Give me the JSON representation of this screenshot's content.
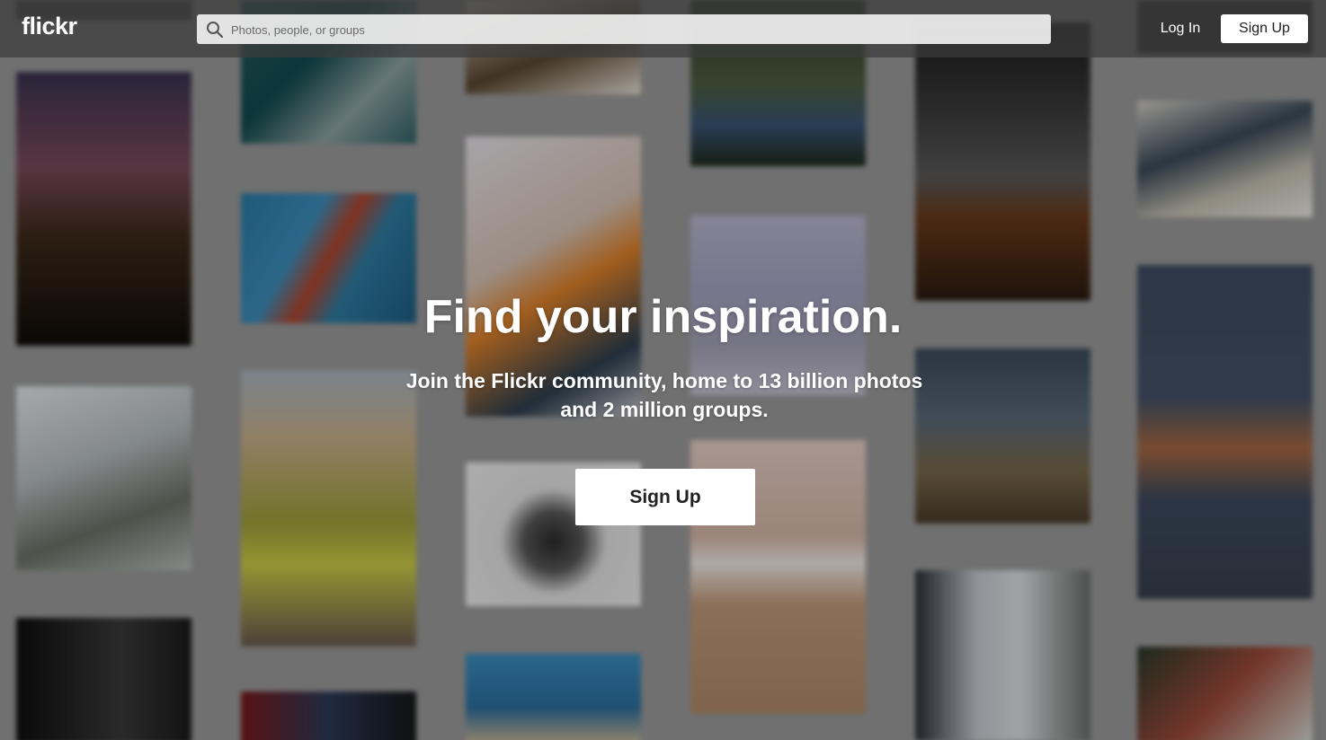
{
  "header": {
    "logo_text": "flickr",
    "search": {
      "placeholder": "Photos, people, or groups"
    },
    "login_label": "Log In",
    "signup_label": "Sign Up"
  },
  "hero": {
    "title": "Find your inspiration.",
    "subtitle": "Join the Flickr community, home to 13 billion photos and 2 million groups.",
    "cta_label": "Sign Up"
  },
  "icons": {
    "search": "search-icon"
  }
}
